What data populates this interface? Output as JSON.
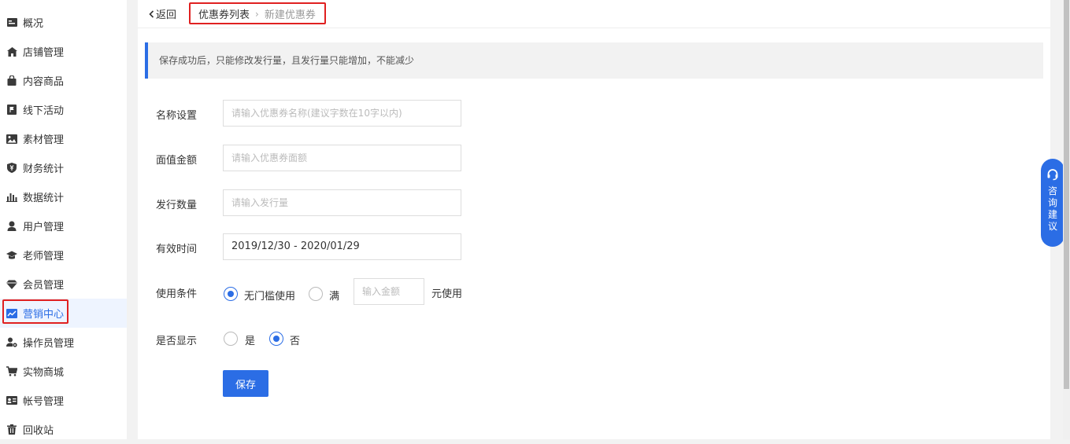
{
  "sidebar": {
    "items": [
      {
        "label": "概况",
        "icon": "overview-icon"
      },
      {
        "label": "店铺管理",
        "icon": "store-icon"
      },
      {
        "label": "内容商品",
        "icon": "shopping-bag-icon"
      },
      {
        "label": "线下活动",
        "icon": "flag-icon"
      },
      {
        "label": "素材管理",
        "icon": "image-icon"
      },
      {
        "label": "财务统计",
        "icon": "yen-shield-icon"
      },
      {
        "label": "数据统计",
        "icon": "bar-chart-icon"
      },
      {
        "label": "用户管理",
        "icon": "user-icon"
      },
      {
        "label": "老师管理",
        "icon": "graduation-cap-icon"
      },
      {
        "label": "会员管理",
        "icon": "diamond-icon"
      },
      {
        "label": "营销中心",
        "icon": "trend-chart-icon"
      },
      {
        "label": "操作员管理",
        "icon": "user-gear-icon"
      },
      {
        "label": "实物商城",
        "icon": "cart-icon"
      },
      {
        "label": "帐号管理",
        "icon": "id-card-icon"
      },
      {
        "label": "回收站",
        "icon": "trash-icon"
      }
    ],
    "active_label": "营销中心"
  },
  "topbar": {
    "back_label": "返回",
    "breadcrumb": [
      "优惠券列表",
      "新建优惠券"
    ]
  },
  "notice": "保存成功后，只能修改发行量，且发行量只能增加，不能减少",
  "form": {
    "name_label": "名称设置",
    "name_placeholder": "请输入优惠券名称(建议字数在10字以内)",
    "amount_label": "面值金额",
    "amount_placeholder": "请输入优惠券面额",
    "quantity_label": "发行数量",
    "quantity_placeholder": "请输入发行量",
    "valid_label": "有效时间",
    "valid_value": "2019/12/30 - 2020/01/29",
    "condition_label": "使用条件",
    "condition_option1": "无门槛使用",
    "condition_option2": "满",
    "condition_amount_placeholder": "输入金额",
    "condition_suffix": "元使用",
    "display_label": "是否显示",
    "display_yes": "是",
    "display_no": "否",
    "save_label": "保存"
  },
  "consult": {
    "label": "咨询建议"
  },
  "colors": {
    "accent": "#2b6de5",
    "highlight": "#e02020"
  }
}
